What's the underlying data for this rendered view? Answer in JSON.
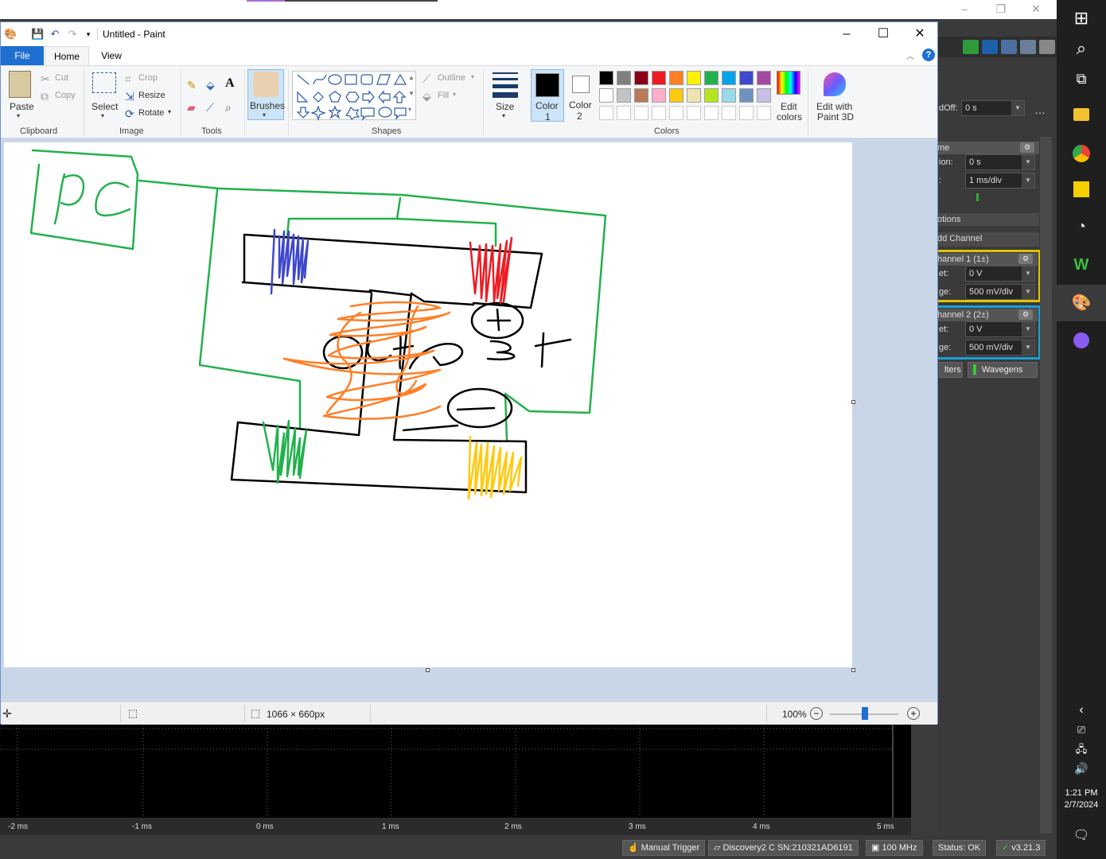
{
  "paint": {
    "title": "Untitled - Paint",
    "tabs": {
      "file": "File",
      "home": "Home",
      "view": "View"
    },
    "clipboard": {
      "paste": "Paste",
      "cut": "Cut",
      "copy": "Copy",
      "group": "Clipboard"
    },
    "image": {
      "select": "Select",
      "crop": "Crop",
      "resize": "Resize",
      "rotate": "Rotate",
      "group": "Image"
    },
    "tools": {
      "group": "Tools"
    },
    "brushes": "Brushes",
    "shapes": {
      "outline": "Outline",
      "fill": "Fill",
      "group": "Shapes"
    },
    "size": "Size",
    "color1": {
      "label1": "Color",
      "label2": "1"
    },
    "color2": {
      "label1": "Color",
      "label2": "2"
    },
    "colors_group": "Colors",
    "edit_colors": {
      "l1": "Edit",
      "l2": "colors"
    },
    "paint3d": {
      "l1": "Edit with",
      "l2": "Paint 3D"
    },
    "palette_row1": [
      "#000000",
      "#7f7f7f",
      "#880015",
      "#ed1c24",
      "#ff7f27",
      "#fff200",
      "#22b14c",
      "#00a2e8",
      "#3f48cc",
      "#a349a4"
    ],
    "palette_row2": [
      "#ffffff",
      "#c3c3c3",
      "#b97a57",
      "#ffaec9",
      "#ffc90e",
      "#efe4b0",
      "#b5e61d",
      "#99d9ea",
      "#7092be",
      "#c8bfe7"
    ],
    "status": {
      "dimensions": "1066 × 660px",
      "zoom": "100%"
    }
  },
  "scope": {
    "offset_label": "dOff:",
    "offset_value": "0 s",
    "time_header": "me",
    "position_label": "ion:",
    "position_value": "0 s",
    "base_label": ":",
    "base_value": "1 ms/div",
    "options": "otions",
    "add_channel": "dd Channel",
    "ch1": {
      "name": "hannel 1 (1±)",
      "offset_label": "et:",
      "offset_value": "0 V",
      "range_label": "ge:",
      "range_value": "500 mV/div"
    },
    "ch2": {
      "name": "hannel 2 (2±)",
      "offset_label": "et:",
      "offset_value": "0 V",
      "range_label": "ge:",
      "range_value": "500 mV/div"
    },
    "filters": "lters",
    "wavegens": "Wavegens",
    "ticks": [
      "-2 ms",
      "-1 ms",
      "0 ms",
      "1 ms",
      "2 ms",
      "3 ms",
      "4 ms",
      "5 ms"
    ],
    "status": {
      "trigger": "Manual Trigger",
      "device": "Discovery2 C SN:210321AD6191",
      "freq": "100 MHz",
      "state": "Status: OK",
      "version": "v3.21.3"
    }
  },
  "taskbar": {
    "time": "1:21 PM",
    "date": "2/7/2024"
  },
  "canvas_text": {
    "label": "PC"
  }
}
